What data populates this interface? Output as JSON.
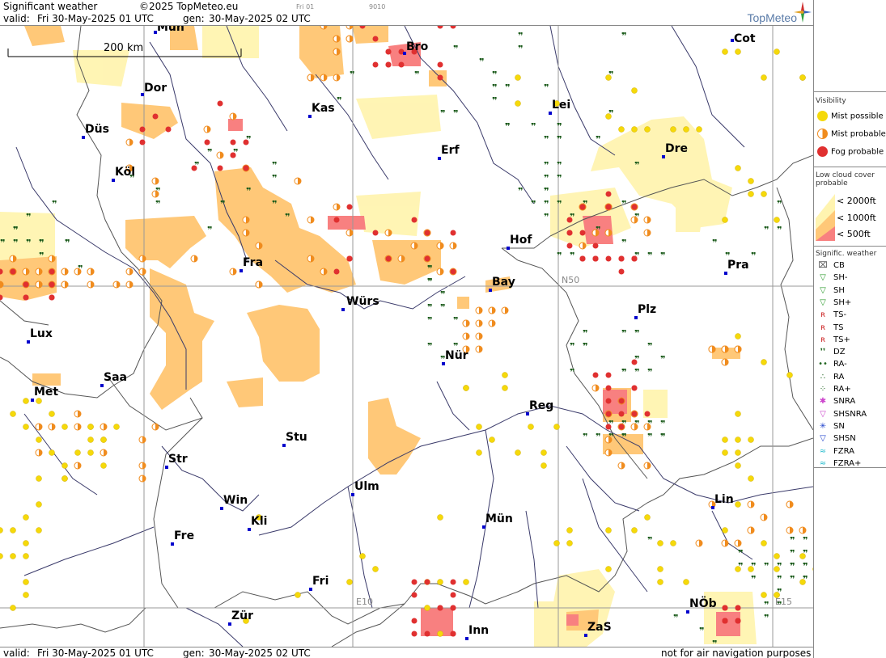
{
  "header": {
    "title": "Significant weather",
    "copyright": "©2025 TopMeteo.eu",
    "run_small": "Fri 01",
    "code_small": "9010",
    "valid_label": "valid:",
    "valid_value": "Fri  30-May-2025  01 UTC",
    "gen_label": "gen:",
    "gen_value": "30-May-2025 02 UTC",
    "brand": "TopMeteo"
  },
  "map": {
    "scale_label": "200 km",
    "grid_labels": {
      "n50": "N50",
      "e10": "E10",
      "e15": "E15"
    },
    "cities": [
      {
        "name": "Mün",
        "id": "muenster"
      },
      {
        "name": "Bro",
        "id": "brocken"
      },
      {
        "name": "Cot",
        "id": "cottbus"
      },
      {
        "name": "Dor",
        "id": "dortmund"
      },
      {
        "name": "Kas",
        "id": "kassel"
      },
      {
        "name": "Lei",
        "id": "leipzig"
      },
      {
        "name": "Düs",
        "id": "duesseldorf"
      },
      {
        "name": "Erf",
        "id": "erfurt"
      },
      {
        "name": "Dre",
        "id": "dresden"
      },
      {
        "name": "Köl",
        "id": "koeln"
      },
      {
        "name": "Hof",
        "id": "hof"
      },
      {
        "name": "Fra",
        "id": "frankfurt"
      },
      {
        "name": "Pra",
        "id": "praha"
      },
      {
        "name": "Bay",
        "id": "bayreuth"
      },
      {
        "name": "Würs",
        "id": "wuerzburg"
      },
      {
        "name": "Plz",
        "id": "plzen"
      },
      {
        "name": "Lux",
        "id": "luxembourg"
      },
      {
        "name": "Nür",
        "id": "nuernberg"
      },
      {
        "name": "Saa",
        "id": "saarbruecken"
      },
      {
        "name": "Met",
        "id": "metz"
      },
      {
        "name": "Reg",
        "id": "regensburg"
      },
      {
        "name": "Stu",
        "id": "stuttgart"
      },
      {
        "name": "Str",
        "id": "strasbourg"
      },
      {
        "name": "Ulm",
        "id": "ulm"
      },
      {
        "name": "Win",
        "id": "winterthur-kli"
      },
      {
        "name": "Kli",
        "id": "klippeneck"
      },
      {
        "name": "Lin",
        "id": "linz"
      },
      {
        "name": "Mün",
        "id": "muenchen"
      },
      {
        "name": "Fre",
        "id": "freiburg"
      },
      {
        "name": "Fri",
        "id": "friedrichshafen"
      },
      {
        "name": "NÖb",
        "id": "noeb"
      },
      {
        "name": "Zür",
        "id": "zuerich"
      },
      {
        "name": "Inn",
        "id": "innsbruck"
      },
      {
        "name": "ZaS",
        "id": "zellamsee"
      }
    ]
  },
  "footer": {
    "valid_label": "valid:",
    "valid_value": "Fri  30-May-2025  01 UTC",
    "gen_label": "gen:",
    "gen_value": "30-May-2025 02 UTC",
    "disclaimer": "not for air navigation purposes"
  },
  "legend": {
    "visibility": {
      "title": "Visibility",
      "items": [
        {
          "label": "Mist possible",
          "color": "#f5d90a"
        },
        {
          "label": "Mist probable",
          "color": "#f08c1e"
        },
        {
          "label": "Fog probable",
          "color": "#e03030"
        }
      ]
    },
    "low_cloud": {
      "title1": "Low cloud cover",
      "title2": "probable",
      "items": [
        {
          "label": "< 2000ft",
          "color": "#fff4b0"
        },
        {
          "label": "< 1000ft",
          "color": "#ffc878"
        },
        {
          "label": "<  500ft",
          "color": "#f88080"
        }
      ]
    },
    "signific": {
      "title": "Signific. weather",
      "items": [
        {
          "label": "CB",
          "symbol": "⌧",
          "color": "#444444"
        },
        {
          "label": "SH-",
          "symbol": "▽",
          "color": "#2a9a2a"
        },
        {
          "label": "SH",
          "symbol": "▽",
          "color": "#2a9a2a"
        },
        {
          "label": "SH+",
          "symbol": "▽",
          "color": "#2a9a2a"
        },
        {
          "label": "TS-",
          "symbol": "ʀ",
          "color": "#cc2222"
        },
        {
          "label": "TS",
          "symbol": "ʀ",
          "color": "#cc2222"
        },
        {
          "label": "TS+",
          "symbol": "ʀ",
          "color": "#cc2222"
        },
        {
          "label": "DZ",
          "symbol": "❜❜",
          "color": "#226622"
        },
        {
          "label": "RA-",
          "symbol": "••",
          "color": "#226622"
        },
        {
          "label": "RA",
          "symbol": "∴",
          "color": "#226622"
        },
        {
          "label": "RA+",
          "symbol": "⁘",
          "color": "#226622"
        },
        {
          "label": "SNRA",
          "symbol": "✱",
          "color": "#cc44cc"
        },
        {
          "label": "SHSNRA",
          "symbol": "▽",
          "color": "#cc44cc"
        },
        {
          "label": "SN",
          "symbol": "✳",
          "color": "#2244cc"
        },
        {
          "label": "SHSN",
          "symbol": "▽",
          "color": "#2244cc"
        },
        {
          "label": "FZRA",
          "symbol": "≈",
          "color": "#22bbcc"
        },
        {
          "label": "FZRA+",
          "symbol": "≈",
          "color": "#22bbcc"
        }
      ]
    }
  }
}
